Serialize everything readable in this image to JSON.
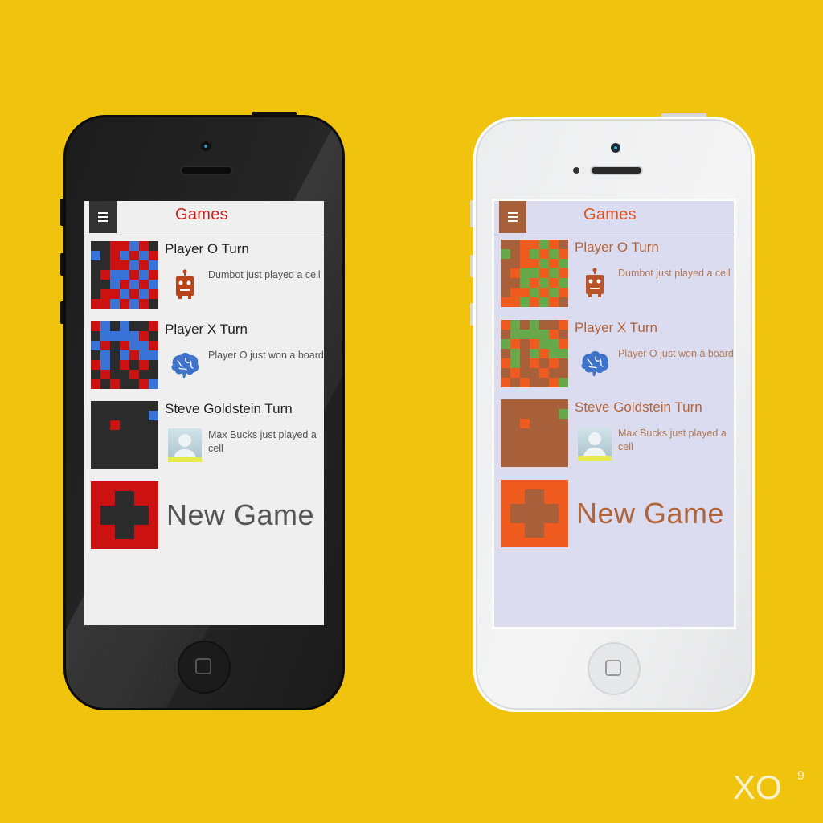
{
  "header": {
    "title": "Games"
  },
  "games": [
    {
      "title": "Player O Turn",
      "avatar": "robot-icon",
      "status": "Dumbot just played a cell"
    },
    {
      "title": "Player X Turn",
      "avatar": "brain-icon",
      "status": "Player O just won a board"
    },
    {
      "title": "Steve Goldstein Turn",
      "avatar": "person-avatar",
      "status": "Max Bucks just played a cell"
    }
  ],
  "new_game": {
    "label": "New Game",
    "icon": "plus-icon"
  },
  "logo": {
    "text": "XO",
    "sup": "9"
  },
  "themes": {
    "dark": {
      "board_bg": "#2b2b2b",
      "x_color": "#cc1111",
      "o_color": "#3a73d6",
      "title_color": "#c8241e",
      "text_color": "#222222",
      "status_color": "#555555",
      "accent": "#cc1111",
      "tile_bg": "#cc1111",
      "tile_cross": "#2b2b2b",
      "label_color": "#555555",
      "menu_bg": "#333333",
      "border": "#cfcfcf"
    },
    "light": {
      "board_bg": "#a8603a",
      "x_color": "#ef5a1f",
      "o_color": "#66a84a",
      "title_color": "#e0561e",
      "text_color": "#b0643a",
      "status_color": "#b07a55",
      "accent": "#ef5a1f",
      "tile_bg": "#ef5a1f",
      "tile_cross": "#a8603a",
      "label_color": "#b0643a",
      "menu_bg": "#a8603a",
      "border": "#b9b9cf"
    }
  },
  "boards": [
    {
      "x": [
        [
          2,
          0
        ],
        [
          3,
          0
        ],
        [
          5,
          0
        ],
        [
          2,
          1
        ],
        [
          4,
          1
        ],
        [
          6,
          1
        ],
        [
          2,
          2
        ],
        [
          3,
          2
        ],
        [
          5,
          2
        ],
        [
          1,
          3
        ],
        [
          4,
          3
        ],
        [
          6,
          3
        ],
        [
          3,
          4
        ],
        [
          5,
          4
        ],
        [
          1,
          5
        ],
        [
          2,
          5
        ],
        [
          4,
          5
        ],
        [
          6,
          5
        ],
        [
          0,
          6
        ],
        [
          1,
          6
        ],
        [
          3,
          6
        ],
        [
          5,
          6
        ]
      ],
      "o": [
        [
          4,
          0
        ],
        [
          0,
          1
        ],
        [
          3,
          1
        ],
        [
          5,
          1
        ],
        [
          4,
          2
        ],
        [
          6,
          2
        ],
        [
          2,
          3
        ],
        [
          3,
          3
        ],
        [
          5,
          3
        ],
        [
          2,
          4
        ],
        [
          4,
          4
        ],
        [
          6,
          4
        ],
        [
          3,
          5
        ],
        [
          5,
          5
        ],
        [
          2,
          6
        ],
        [
          4,
          6
        ]
      ]
    },
    {
      "x": [
        [
          0,
          0
        ],
        [
          6,
          0
        ],
        [
          5,
          1
        ],
        [
          1,
          2
        ],
        [
          3,
          2
        ],
        [
          6,
          2
        ],
        [
          4,
          3
        ],
        [
          0,
          4
        ],
        [
          3,
          4
        ],
        [
          5,
          4
        ],
        [
          1,
          5
        ],
        [
          4,
          5
        ],
        [
          0,
          6
        ],
        [
          2,
          6
        ],
        [
          5,
          6
        ]
      ],
      "o": [
        [
          1,
          0
        ],
        [
          3,
          0
        ],
        [
          1,
          1
        ],
        [
          2,
          1
        ],
        [
          3,
          1
        ],
        [
          4,
          1
        ],
        [
          0,
          2
        ],
        [
          4,
          2
        ],
        [
          5,
          2
        ],
        [
          1,
          3
        ],
        [
          3,
          3
        ],
        [
          5,
          3
        ],
        [
          6,
          3
        ],
        [
          1,
          4
        ],
        [
          6,
          6
        ]
      ]
    },
    {
      "x": [
        [
          2,
          2
        ]
      ],
      "o": [
        [
          6,
          1
        ]
      ]
    }
  ]
}
